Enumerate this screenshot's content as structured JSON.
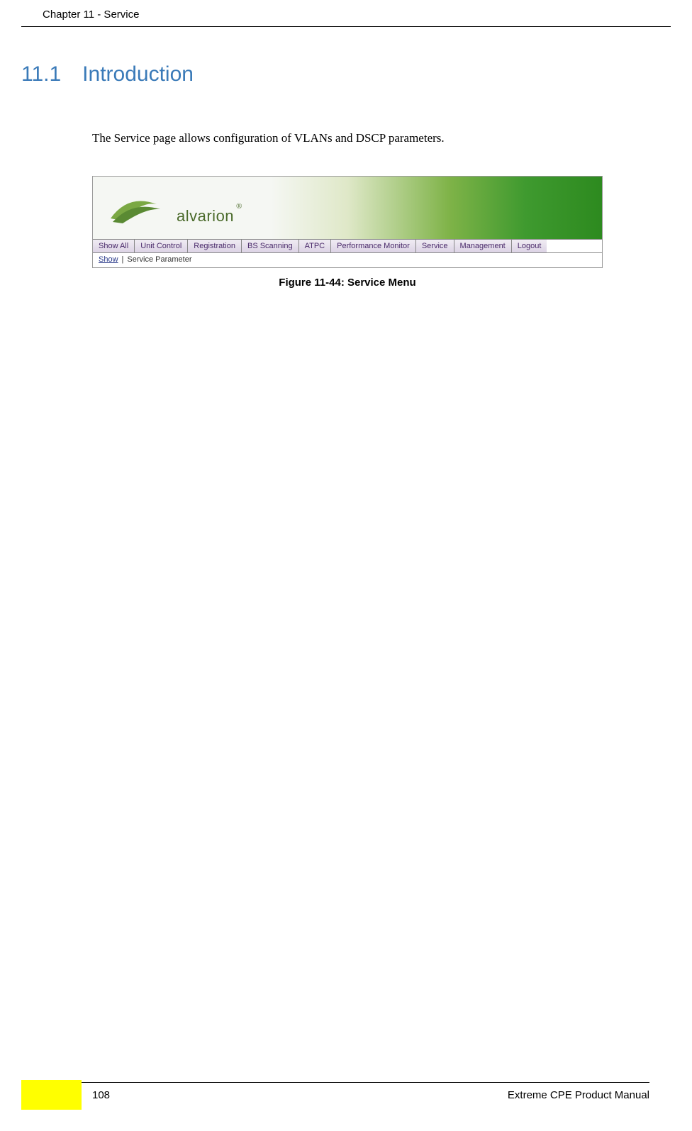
{
  "header": {
    "chapter_label": "Chapter 11 - Service"
  },
  "section": {
    "number": "11.1",
    "title": "Introduction"
  },
  "body": {
    "paragraph1": "The Service page allows configuration of VLANs and DSCP parameters."
  },
  "screenshot": {
    "logo_text": "alvarion",
    "registered": "®",
    "tabs": [
      "Show All",
      "Unit Control",
      "Registration",
      "BS Scanning",
      "ATPC",
      "Performance Monitor",
      "Service",
      "Management",
      "Logout"
    ],
    "subnav": {
      "link": "Show",
      "separator": "|",
      "text": "Service Parameter"
    }
  },
  "figure": {
    "caption": "Figure 11-44: Service Menu"
  },
  "footer": {
    "page_number": "108",
    "manual_title": "Extreme CPE Product Manual"
  }
}
